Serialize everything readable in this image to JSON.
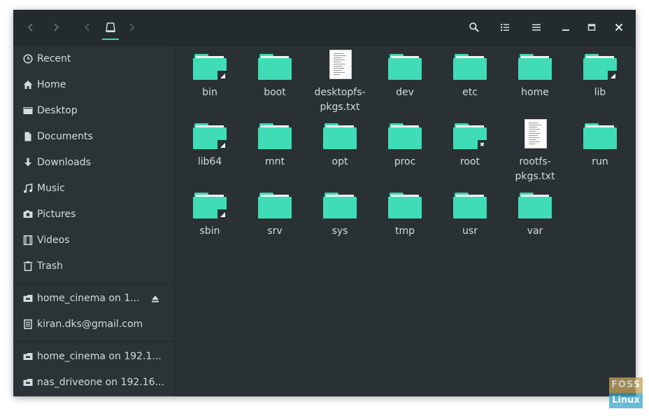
{
  "window": {
    "header": {
      "back_icon": "chevron-left-icon",
      "forward_icon": "chevron-right-icon",
      "path_icon": "drive-icon",
      "search_icon": "search-icon",
      "view_icon": "list-view-icon",
      "menu_icon": "hamburger-menu-icon",
      "minimize_icon": "minimize-icon",
      "maximize_icon": "maximize-icon",
      "close_icon": "close-icon"
    },
    "sidebar": {
      "places": [
        {
          "label": "Recent",
          "icon": "clock-icon"
        },
        {
          "label": "Home",
          "icon": "home-icon"
        },
        {
          "label": "Desktop",
          "icon": "desktop-icon"
        },
        {
          "label": "Documents",
          "icon": "document-icon"
        },
        {
          "label": "Downloads",
          "icon": "download-icon"
        },
        {
          "label": "Music",
          "icon": "music-icon"
        },
        {
          "label": "Pictures",
          "icon": "camera-icon"
        },
        {
          "label": "Videos",
          "icon": "film-icon"
        },
        {
          "label": "Trash",
          "icon": "trash-icon"
        }
      ],
      "devices": [
        {
          "label": "home_cinema on 1...",
          "icon": "network-drive-icon",
          "eject_icon": "eject-icon"
        },
        {
          "label": "kiran.dks@gmail.com",
          "icon": "online-account-icon"
        }
      ],
      "network": [
        {
          "label": "home_cinema on 192.1...",
          "icon": "network-drive-icon"
        },
        {
          "label": "nas_driveone on 192.16...",
          "icon": "network-drive-icon"
        }
      ]
    },
    "files": [
      {
        "name": "bin",
        "kind": "folder",
        "emblem": "link"
      },
      {
        "name": "boot",
        "kind": "folder"
      },
      {
        "name": "desktopfs-\npkgs.txt",
        "kind": "text"
      },
      {
        "name": "dev",
        "kind": "folder"
      },
      {
        "name": "etc",
        "kind": "folder"
      },
      {
        "name": "home",
        "kind": "folder"
      },
      {
        "name": "lib",
        "kind": "folder",
        "emblem": "link"
      },
      {
        "name": "lib64",
        "kind": "folder",
        "emblem": "link"
      },
      {
        "name": "mnt",
        "kind": "folder"
      },
      {
        "name": "opt",
        "kind": "folder"
      },
      {
        "name": "proc",
        "kind": "folder"
      },
      {
        "name": "root",
        "kind": "folder",
        "emblem": "locked"
      },
      {
        "name": "rootfs-\npkgs.txt",
        "kind": "text"
      },
      {
        "name": "run",
        "kind": "folder"
      },
      {
        "name": "sbin",
        "kind": "folder",
        "emblem": "link"
      },
      {
        "name": "srv",
        "kind": "folder"
      },
      {
        "name": "sys",
        "kind": "folder"
      },
      {
        "name": "tmp",
        "kind": "folder"
      },
      {
        "name": "usr",
        "kind": "folder"
      },
      {
        "name": "var",
        "kind": "folder"
      }
    ],
    "colors": {
      "folder": "#40dcb5",
      "accent": "#3fd9b1",
      "background": "#2a3135",
      "text": "#d4dbdf"
    }
  },
  "watermark": {
    "top": "FOSS",
    "bottom": "Linux"
  }
}
